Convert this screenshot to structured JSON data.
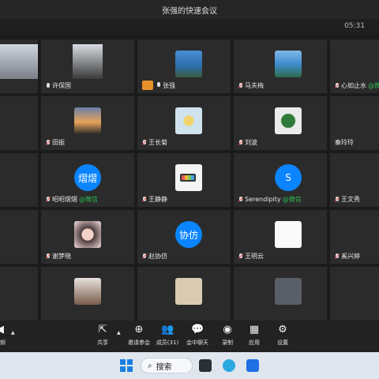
{
  "window": {
    "title": "张强的快速会议",
    "time": "05:31"
  },
  "colors": {
    "accent_blue": "#0a84ff",
    "wechat_green": "#2dbb4f",
    "host_badge": "#e8912a",
    "toolbar_bg": "#222222"
  },
  "participants": [
    {
      "name": "",
      "mic": ""
    },
    {
      "name": "许保国",
      "mic": "on"
    },
    {
      "name": "张强",
      "mic": "on",
      "host": true
    },
    {
      "name": "马夫梅",
      "mic": "off"
    },
    {
      "name": "心如止水",
      "suffix": "@微信",
      "mic": "off"
    },
    {
      "name": "",
      "mic": ""
    },
    {
      "name": "田振",
      "mic": "off"
    },
    {
      "name": "王长菊",
      "mic": "off"
    },
    {
      "name": "刘波",
      "mic": "off"
    },
    {
      "name": "秦玲玲",
      "mic": ""
    },
    {
      "name": "",
      "mic": ""
    },
    {
      "name": "昭昭熠熠",
      "suffix": "@微信",
      "mic": "off",
      "avatar_text": "熠熠"
    },
    {
      "name": "王静静",
      "mic": "off"
    },
    {
      "name": "Serendipity",
      "suffix": "@微信",
      "mic": "off",
      "avatar_text": "S"
    },
    {
      "name": "王文秀",
      "mic": "off"
    },
    {
      "name": "",
      "mic": ""
    },
    {
      "name": "谢梦晓",
      "mic": "off"
    },
    {
      "name": "赵协仿",
      "mic": "off",
      "avatar_text": "协仿"
    },
    {
      "name": "王明云",
      "mic": "off"
    },
    {
      "name": "奚兴婷",
      "mic": "off"
    }
  ],
  "toolbar": {
    "share": "共享",
    "invite": "邀请参会",
    "members": "成员(31)",
    "chat": "会中聊天",
    "record": "录制",
    "apps": "应用",
    "settings": "设置",
    "video": "视频"
  },
  "taskbar": {
    "search_label": "搜索"
  }
}
